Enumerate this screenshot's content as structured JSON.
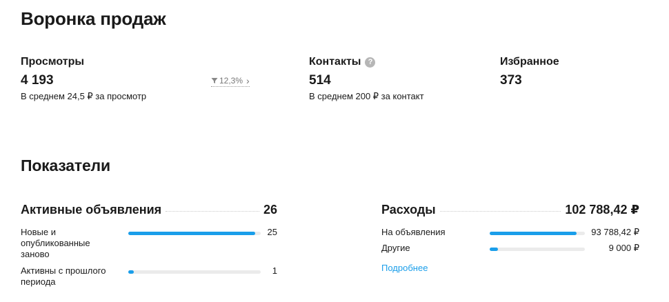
{
  "funnel": {
    "title": "Воронка продаж",
    "views": {
      "label": "Просмотры",
      "value": "4 193",
      "sub": "В среднем 24,5 ₽ за просмотр",
      "trend": "12,3%",
      "trend_icon": "funnel-down-icon"
    },
    "contacts": {
      "label": "Контакты",
      "help_icon": "?",
      "value": "514",
      "sub": "В среднем 200 ₽ за контакт"
    },
    "favorites": {
      "label": "Избранное",
      "value": "373"
    }
  },
  "indicators": {
    "title": "Показатели",
    "active_ads": {
      "title": "Активные объявления",
      "total": "26",
      "rows": [
        {
          "label": "Новые и опубликованные заново",
          "value": "25",
          "fraction": 0.96
        },
        {
          "label": "Активны с прошлого периода",
          "value": "1",
          "fraction": 0.04
        }
      ]
    },
    "expenses": {
      "title": "Расходы",
      "total": "102 788,42 ₽",
      "rows": [
        {
          "label": "На объявления",
          "value": "93 788,42 ₽",
          "fraction": 0.91
        },
        {
          "label": "Другие",
          "value": "9 000 ₽",
          "fraction": 0.09
        }
      ],
      "more_link": "Подробнее"
    }
  },
  "colors": {
    "accent": "#1a9eea",
    "track": "#ebebeb",
    "muted": "#777777"
  }
}
